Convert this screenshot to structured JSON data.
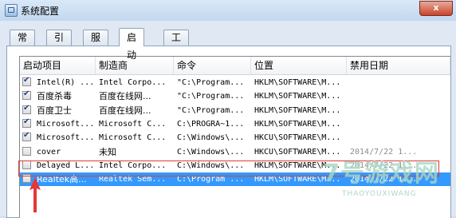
{
  "window": {
    "title": "系统配置",
    "close_glyph": "x"
  },
  "tabs": [
    {
      "label": "常规",
      "active": false
    },
    {
      "label": "引导",
      "active": false
    },
    {
      "label": "服务",
      "active": false
    },
    {
      "label": "启动",
      "active": true
    },
    {
      "label": "工具",
      "active": false
    }
  ],
  "columns": [
    "启动项目",
    "制造商",
    "命令",
    "位置",
    "禁用日期"
  ],
  "rows": [
    {
      "checked": true,
      "item": "Intel(R) ...",
      "maker": "Intel Corpo...",
      "command": "\"C:\\Program...",
      "location": "HKLM\\SOFTWARE\\M...",
      "date": ""
    },
    {
      "checked": true,
      "item": "百度杀毒",
      "maker": "百度在线网...",
      "command": "\"C:\\Program...",
      "location": "HKLM\\SOFTWARE\\M...",
      "date": ""
    },
    {
      "checked": true,
      "item": "百度卫士",
      "maker": "百度在线网...",
      "command": "\"C:\\Program...",
      "location": "HKLM\\SOFTWARE\\M...",
      "date": ""
    },
    {
      "checked": true,
      "item": "Microsoft...",
      "maker": "Microsoft C...",
      "command": "C:\\PROGRA~1...",
      "location": "HKLM\\SOFTWARE\\M...",
      "date": ""
    },
    {
      "checked": true,
      "item": "Microsoft...",
      "maker": "Microsoft C...",
      "command": "C:\\Windows\\...",
      "location": "HKCU\\SOFTWARE\\M...",
      "date": ""
    },
    {
      "checked": false,
      "item": "cover",
      "maker": "未知",
      "command": "C:\\Windows\\...",
      "location": "HKCU\\SOFTWARE\\M...",
      "date": "2014/7/22 1..."
    },
    {
      "checked": false,
      "item": "Delayed L...",
      "maker": "Intel Corpo...",
      "command": "C:\\Windows\\...",
      "location": "HKLM\\SOFTWARE\\M...",
      "date": "2014/7/22 1..."
    },
    {
      "checked": false,
      "item": "Realtek高...",
      "maker": "Realtek Sem...",
      "command": "C:\\Program ...",
      "location": "HKLM\\SOFTWARE\\M...",
      "date": "2014/7/22 1...",
      "selected": true
    }
  ],
  "watermark": {
    "main": "7号游戏网",
    "sub": "THAOYOUXIWANG"
  },
  "colors": {
    "selection": "#3399ff",
    "annotation": "#e23838"
  }
}
